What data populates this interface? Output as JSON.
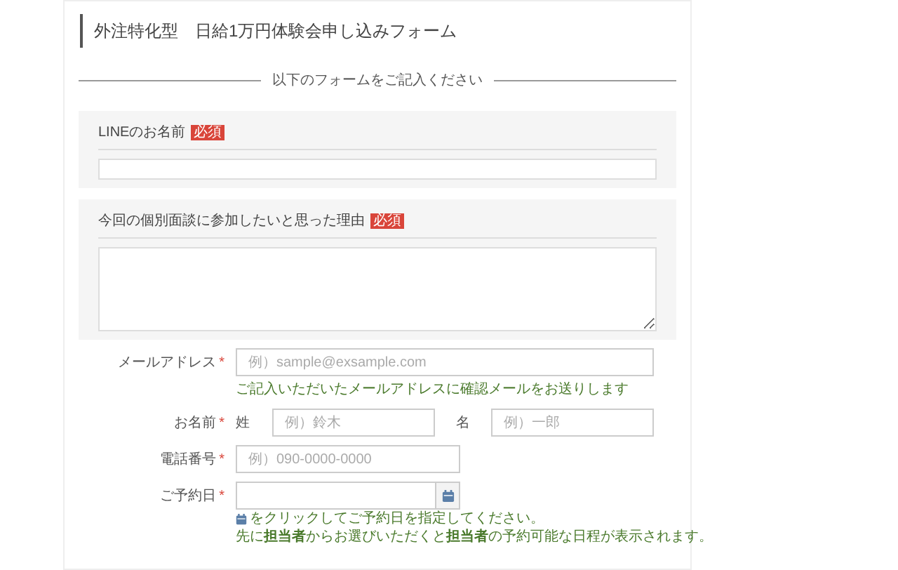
{
  "title": "外注特化型　日給1万円体験会申し込みフォーム",
  "divider_text": "以下のフォームをご記入ください",
  "sections": [
    {
      "label": "LINEのお名前",
      "badge": "必須",
      "kind": "input"
    },
    {
      "label": "今回の個別面談に参加したいと思った理由",
      "badge": "必須",
      "kind": "textarea"
    }
  ],
  "fields": [
    {
      "kind": "email",
      "label": "メールアドレス",
      "mark": "*",
      "placeholder": "例）sample@exsample.com",
      "hints": [
        "ご記入いただいたメールアドレスに確認メールをお送りします"
      ]
    },
    {
      "kind": "name",
      "label": "お名前",
      "mark": "*",
      "parts": [
        {
          "label": "姓",
          "placeholder": "例）鈴木"
        },
        {
          "label": "名",
          "placeholder": "例）一郎"
        }
      ]
    },
    {
      "kind": "phone",
      "label": "電話番号",
      "mark": "*",
      "placeholder": "例）090-0000-0000"
    },
    {
      "kind": "date",
      "label": "ご予約日",
      "mark": "*",
      "hints": [
        "をクリックしてご予約日を指定してください。",
        "先に**担当者**からお選びいただくと**担当者**の予約可能な日程が表示されます。"
      ]
    }
  ]
}
